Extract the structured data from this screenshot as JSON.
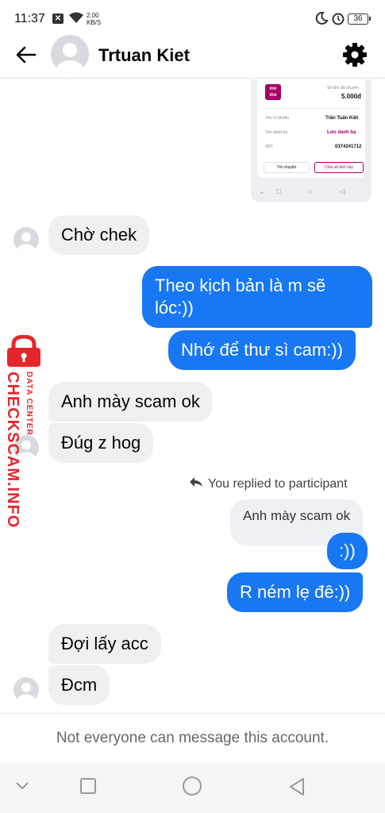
{
  "status_bar": {
    "time": "11:37",
    "network_speed_value": "2.00",
    "network_speed_unit": "KB/S",
    "battery": "36"
  },
  "header": {
    "title": "Trtuan Kiet"
  },
  "shared_image": {
    "brand": "MoMo",
    "amount_label": "Số tiền đã chuyển",
    "amount": "5.000đ",
    "wallet_label": "Tên Ví MoMo",
    "wallet_name": "Trần Tuấn Kiệt",
    "contact_label": "Tên danh bạ",
    "contact_action": "Lưu danh bạ",
    "phone_label": "SĐT",
    "phone": "0374241712",
    "btn_chat": "Trò chuyện",
    "btn_share": "Chia sẻ ảnh này"
  },
  "messages": [
    {
      "dir": "in",
      "text": "Chờ chek"
    },
    {
      "dir": "out",
      "text": "Theo kịch bản là m sẽ lóc:))"
    },
    {
      "dir": "out",
      "text": "Nhớ để thư sì cam:))"
    },
    {
      "dir": "in",
      "text": "Anh mày scam ok"
    },
    {
      "dir": "in",
      "text": "Đúg z hog"
    },
    {
      "dir": "out",
      "text": ":))"
    },
    {
      "dir": "out",
      "text": "R ném lẹ đê:))"
    },
    {
      "dir": "in",
      "text": "Đợi lấy acc"
    },
    {
      "dir": "in",
      "text": "Đcm"
    }
  ],
  "reply": {
    "note": "You replied to participant",
    "quoted_text": "Anh mày scam ok"
  },
  "watermark": {
    "main": "CHECKSCAM.INFO",
    "sub": "DATA CENTER"
  },
  "footer": {
    "notice": "Not everyone can message this account."
  },
  "colors": {
    "outgoing_bubble": "#1877f2",
    "incoming_bubble": "#f0f0f0",
    "watermark": "#e3262b",
    "momo_brand": "#a50064"
  }
}
